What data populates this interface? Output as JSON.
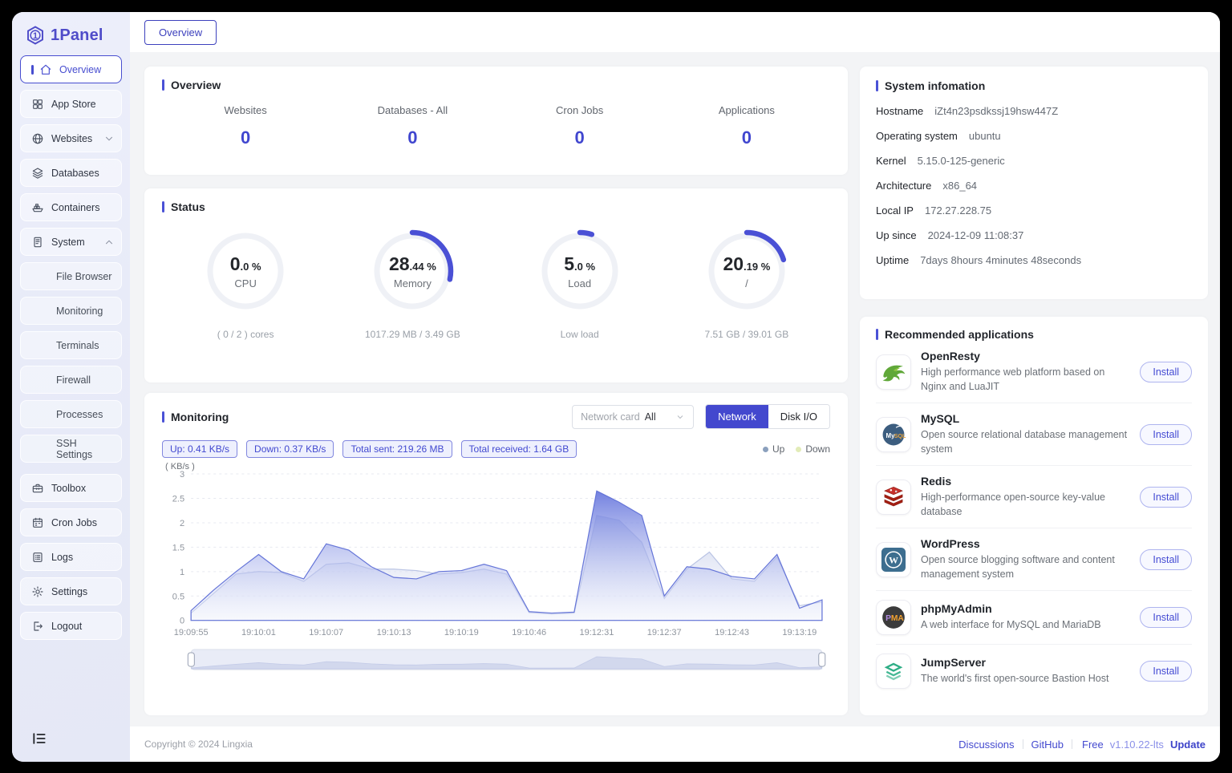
{
  "brand": {
    "name": "1Panel",
    "logo_glyph": "1",
    "color": "#4f4cc9"
  },
  "window": {
    "tab_label": "Overview"
  },
  "sidebar": {
    "items": [
      {
        "id": "overview",
        "label": "Overview",
        "icon": "home-icon",
        "active": true
      },
      {
        "id": "app-store",
        "label": "App Store",
        "icon": "app-grid-icon"
      },
      {
        "id": "websites",
        "label": "Websites",
        "icon": "globe-icon",
        "chevron": "down"
      },
      {
        "id": "databases",
        "label": "Databases",
        "icon": "layers-icon"
      },
      {
        "id": "containers",
        "label": "Containers",
        "icon": "container-ship-icon"
      },
      {
        "id": "system",
        "label": "System",
        "icon": "server-icon",
        "chevron": "up"
      },
      {
        "id": "file-browser",
        "label": "File Browser",
        "sub": true
      },
      {
        "id": "monitoring",
        "label": "Monitoring",
        "sub": true
      },
      {
        "id": "terminals",
        "label": "Terminals",
        "sub": true
      },
      {
        "id": "firewall",
        "label": "Firewall",
        "sub": true
      },
      {
        "id": "processes",
        "label": "Processes",
        "sub": true
      },
      {
        "id": "ssh-settings",
        "label": "SSH Settings",
        "sub": true
      },
      {
        "id": "toolbox",
        "label": "Toolbox",
        "icon": "toolbox-icon",
        "group_gap": true
      },
      {
        "id": "cron-jobs",
        "label": "Cron Jobs",
        "icon": "calendar-icon"
      },
      {
        "id": "logs",
        "label": "Logs",
        "icon": "logs-icon"
      },
      {
        "id": "settings",
        "label": "Settings",
        "icon": "gear-icon"
      },
      {
        "id": "logout",
        "label": "Logout",
        "icon": "logout-icon"
      }
    ]
  },
  "overview": {
    "title": "Overview",
    "stats": [
      {
        "label": "Websites",
        "value": "0"
      },
      {
        "label": "Databases - All",
        "value": "0"
      },
      {
        "label": "Cron Jobs",
        "value": "0"
      },
      {
        "label": "Applications",
        "value": "0"
      }
    ]
  },
  "status": {
    "title": "Status",
    "gauge_color": "#4a50d5",
    "gauges": [
      {
        "id": "cpu",
        "percent": 0,
        "value_main": "0",
        "value_rest": ".0 %",
        "label": "CPU",
        "detail": "( 0 / 2 ) cores"
      },
      {
        "id": "memory",
        "percent": 28.44,
        "value_main": "28",
        "value_rest": ".44 %",
        "label": "Memory",
        "detail": "1017.29 MB / 3.49 GB"
      },
      {
        "id": "load",
        "percent": 5,
        "value_main": "5",
        "value_rest": ".0 %",
        "label": "Load",
        "detail": "Low load"
      },
      {
        "id": "root-disk",
        "percent": 20.19,
        "value_main": "20",
        "value_rest": ".19 %",
        "label": "/",
        "detail": "7.51 GB / 39.01 GB"
      }
    ]
  },
  "monitoring": {
    "title": "Monitoring",
    "network_card": {
      "prefix": "Network card",
      "value": "All"
    },
    "toggle_network_label": "Network",
    "toggle_disk_label": "Disk I/O",
    "badges": [
      "Up: 0.41 KB/s",
      "Down: 0.37 KB/s",
      "Total sent: 219.26 MB",
      "Total received: 1.64 GB"
    ],
    "legend": [
      {
        "label": "Up",
        "color": "#8ba0bd"
      },
      {
        "label": "Down",
        "color": "#e2ecb8"
      }
    ],
    "chart_data": {
      "type": "area",
      "unit_label": "( KB/s )",
      "ylim": [
        0,
        3
      ],
      "yticks": [
        0,
        0.5,
        1,
        1.5,
        2,
        2.5,
        3
      ],
      "x_labels": [
        "19:09:55",
        "19:10:01",
        "19:10:07",
        "19:10:13",
        "19:10:19",
        "19:10:46",
        "19:12:31",
        "19:12:37",
        "19:12:43",
        "19:13:19"
      ],
      "label_indices": [
        0,
        3,
        6,
        9,
        12,
        15,
        18,
        21,
        24,
        27
      ],
      "grid": true,
      "legend_position": "top-right",
      "series": [
        {
          "name": "Up",
          "line": "#6575d8",
          "values": [
            0.2,
            0.62,
            1.0,
            1.35,
            1.0,
            0.85,
            1.57,
            1.44,
            1.1,
            0.88,
            0.85,
            1.0,
            1.02,
            1.15,
            1.02,
            0.18,
            0.15,
            0.17,
            2.65,
            2.42,
            2.15,
            0.5,
            1.1,
            1.05,
            0.9,
            0.85,
            1.35,
            0.25,
            0.42
          ]
        },
        {
          "name": "Down",
          "line": "#bac4e4",
          "values": [
            0.15,
            0.55,
            0.95,
            1.0,
            0.98,
            0.8,
            1.15,
            1.18,
            1.05,
            1.05,
            1.02,
            0.95,
            0.98,
            1.05,
            0.95,
            0.16,
            0.13,
            0.15,
            2.15,
            2.05,
            1.6,
            0.45,
            1.05,
            1.4,
            0.85,
            0.8,
            1.3,
            0.3,
            0.38
          ]
        }
      ]
    }
  },
  "system_info": {
    "title": "System infomation",
    "rows": [
      {
        "label": "Hostname",
        "value": "iZt4n23psdkssj19hsw447Z"
      },
      {
        "label": "Operating system",
        "value": "ubuntu"
      },
      {
        "label": "Kernel",
        "value": "5.15.0-125-generic"
      },
      {
        "label": "Architecture",
        "value": "x86_64"
      },
      {
        "label": "Local IP",
        "value": "172.27.228.75"
      },
      {
        "label": "Up since",
        "value": "2024-12-09 11:08:37"
      },
      {
        "label": "Uptime",
        "value": "7days 8hours 4minutes 48seconds"
      }
    ]
  },
  "apps": {
    "title": "Recommended applications",
    "install_label": "Install",
    "items": [
      {
        "id": "openresty",
        "name": "OpenResty",
        "icon": "openresty-icon",
        "desc": "High performance web platform based on Nginx and LuaJIT"
      },
      {
        "id": "mysql",
        "name": "MySQL",
        "icon": "mysql-icon",
        "desc": "Open source relational database management system"
      },
      {
        "id": "redis",
        "name": "Redis",
        "icon": "redis-icon",
        "desc": "High-performance open-source key-value database"
      },
      {
        "id": "wordpress",
        "name": "WordPress",
        "icon": "wordpress-icon",
        "desc": "Open source blogging software and content management system"
      },
      {
        "id": "phpmyadmin",
        "name": "phpMyAdmin",
        "icon": "phpmyadmin-icon",
        "desc": "A web interface for MySQL and MariaDB"
      },
      {
        "id": "jumpserver",
        "name": "JumpServer",
        "icon": "jumpserver-icon",
        "desc": "The world's first open-source Bastion Host"
      }
    ]
  },
  "footer": {
    "copyright": "Copyright © 2024 Lingxia",
    "links": [
      "Discussions",
      "GitHub"
    ],
    "edition": "Free",
    "version": "v1.10.22-lts",
    "update_label": "Update"
  }
}
